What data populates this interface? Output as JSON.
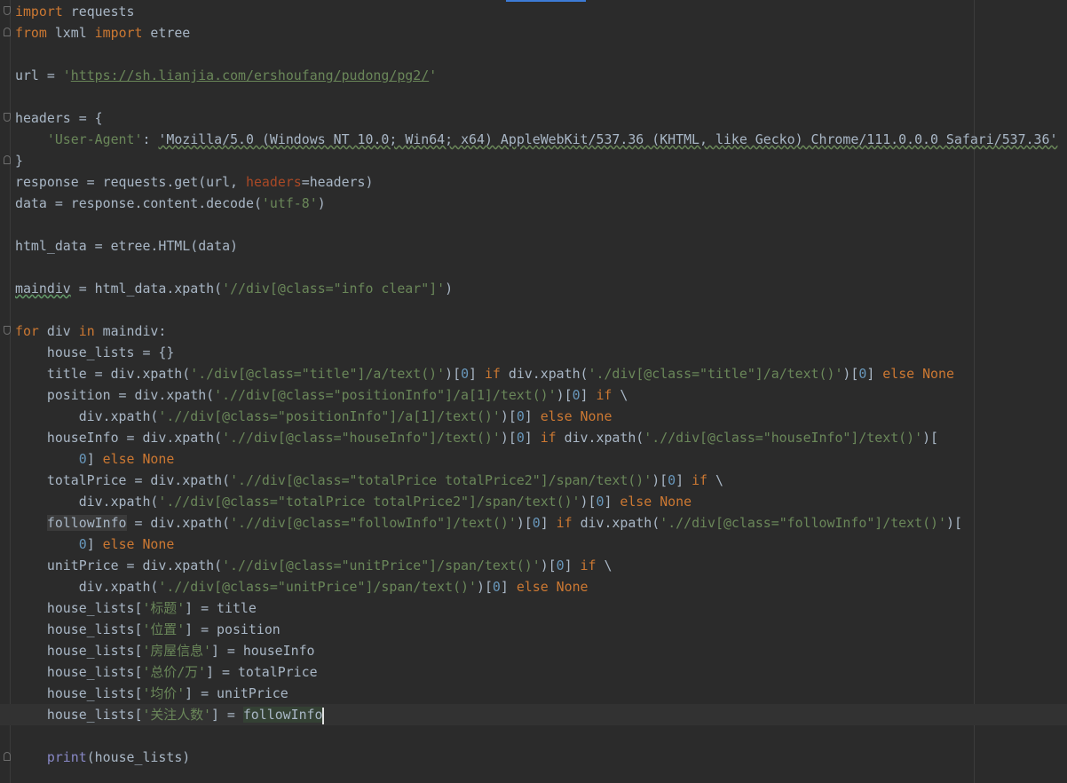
{
  "editor": {
    "theme_colors": {
      "background": "#2b2b2b",
      "keyword": "#cc7832",
      "string": "#6a8759",
      "number": "#6897bb",
      "identifier": "#a9b7c6",
      "kwarg": "#aa4926",
      "builtin": "#8888c6"
    },
    "current_line": 33,
    "lines": [
      {
        "fold": "start",
        "tokens": [
          [
            "kw",
            "import"
          ],
          [
            "id",
            " requests"
          ]
        ]
      },
      {
        "fold": "end",
        "tokens": [
          [
            "kw",
            "from"
          ],
          [
            "id",
            " lxml "
          ],
          [
            "kw",
            "import"
          ],
          [
            "id",
            " etree"
          ]
        ]
      },
      {
        "tokens": []
      },
      {
        "tokens": [
          [
            "id",
            "url = "
          ],
          [
            "str",
            "'"
          ],
          [
            "url",
            "https://sh.lianjia.com/ershoufang/pudong/pg2/"
          ],
          [
            "str",
            "'"
          ]
        ]
      },
      {
        "tokens": []
      },
      {
        "fold": "start",
        "tokens": [
          [
            "id",
            "headers = {"
          ]
        ]
      },
      {
        "tokens": [
          [
            "id",
            "    "
          ],
          [
            "str",
            "'User-Agent'"
          ],
          [
            "id",
            ": "
          ],
          [
            "wavy",
            "'Mozilla/5.0 (Windows NT 10.0; Win64; x64) AppleWebKit/537.36 (KHTML, like Gecko) Chrome/111.0.0.0 Safari/537.36'"
          ]
        ]
      },
      {
        "fold": "end",
        "tokens": [
          [
            "id",
            "}"
          ]
        ]
      },
      {
        "tokens": [
          [
            "id",
            "response = requests.get(url, "
          ],
          [
            "kwarg",
            "headers"
          ],
          [
            "id",
            "=headers)"
          ]
        ]
      },
      {
        "tokens": [
          [
            "id",
            "data = response.content.decode("
          ],
          [
            "str",
            "'utf-8'"
          ],
          [
            "id",
            ")"
          ]
        ]
      },
      {
        "tokens": []
      },
      {
        "tokens": [
          [
            "id",
            "html_data = etree.HTML(data)"
          ]
        ]
      },
      {
        "tokens": []
      },
      {
        "tokens": [
          [
            "typo",
            "maindiv"
          ],
          [
            "id",
            " = html_data.xpath("
          ],
          [
            "str",
            "'//div[@class=\"info clear\"]'"
          ],
          [
            "id",
            ")"
          ]
        ]
      },
      {
        "tokens": []
      },
      {
        "fold": "start",
        "tokens": [
          [
            "kw",
            "for"
          ],
          [
            "id",
            " div "
          ],
          [
            "kw",
            "in"
          ],
          [
            "id",
            " maindiv:"
          ]
        ]
      },
      {
        "tokens": [
          [
            "id",
            "    house_lists = {}"
          ]
        ]
      },
      {
        "tokens": [
          [
            "id",
            "    title = div.xpath("
          ],
          [
            "str",
            "'./div[@class=\"title\"]/a/text()'"
          ],
          [
            "id",
            ")["
          ],
          [
            "num",
            "0"
          ],
          [
            "id",
            "] "
          ],
          [
            "kw",
            "if"
          ],
          [
            "id",
            " div.xpath("
          ],
          [
            "str",
            "'./div[@class=\"title\"]/a/text()'"
          ],
          [
            "id",
            ")["
          ],
          [
            "num",
            "0"
          ],
          [
            "id",
            "] "
          ],
          [
            "kw",
            "else None"
          ]
        ]
      },
      {
        "tokens": [
          [
            "id",
            "    position = div.xpath("
          ],
          [
            "str",
            "'.//div[@class=\"positionInfo\"]/a[1]/text()'"
          ],
          [
            "id",
            ")["
          ],
          [
            "num",
            "0"
          ],
          [
            "id",
            "] "
          ],
          [
            "kw",
            "if"
          ],
          [
            "id",
            " \\"
          ]
        ]
      },
      {
        "tokens": [
          [
            "id",
            "        div.xpath("
          ],
          [
            "str",
            "'.//div[@class=\"positionInfo\"]/a[1]/text()'"
          ],
          [
            "id",
            ")["
          ],
          [
            "num",
            "0"
          ],
          [
            "id",
            "] "
          ],
          [
            "kw",
            "else None"
          ]
        ]
      },
      {
        "tokens": [
          [
            "id",
            "    houseInfo = div.xpath("
          ],
          [
            "str",
            "'.//div[@class=\"houseInfo\"]/text()'"
          ],
          [
            "id",
            ")["
          ],
          [
            "num",
            "0"
          ],
          [
            "id",
            "] "
          ],
          [
            "kw",
            "if"
          ],
          [
            "id",
            " div.xpath("
          ],
          [
            "str",
            "'.//div[@class=\"houseInfo\"]/text()'"
          ],
          [
            "id",
            ")["
          ]
        ]
      },
      {
        "tokens": [
          [
            "id",
            "        "
          ],
          [
            "num",
            "0"
          ],
          [
            "id",
            "] "
          ],
          [
            "kw",
            "else None"
          ]
        ]
      },
      {
        "tokens": [
          [
            "id",
            "    totalPrice = div.xpath("
          ],
          [
            "str",
            "'.//div[@class=\"totalPrice totalPrice2\"]/span/text()'"
          ],
          [
            "id",
            ")["
          ],
          [
            "num",
            "0"
          ],
          [
            "id",
            "] "
          ],
          [
            "kw",
            "if"
          ],
          [
            "id",
            " \\"
          ]
        ]
      },
      {
        "tokens": [
          [
            "id",
            "        div.xpath("
          ],
          [
            "str",
            "'.//div[@class=\"totalPrice totalPrice2\"]/span/text()'"
          ],
          [
            "id",
            ")["
          ],
          [
            "num",
            "0"
          ],
          [
            "id",
            "] "
          ],
          [
            "kw",
            "else None"
          ]
        ]
      },
      {
        "tokens": [
          [
            "id",
            "    "
          ],
          [
            "usage2",
            "followInfo"
          ],
          [
            "id",
            " = div.xpath("
          ],
          [
            "str",
            "'.//div[@class=\"followInfo\"]/text()'"
          ],
          [
            "id",
            ")["
          ],
          [
            "num",
            "0"
          ],
          [
            "id",
            "] "
          ],
          [
            "kw",
            "if"
          ],
          [
            "id",
            " div.xpath("
          ],
          [
            "str",
            "'.//div[@class=\"followInfo\"]/text()'"
          ],
          [
            "id",
            ")["
          ]
        ]
      },
      {
        "tokens": [
          [
            "id",
            "        "
          ],
          [
            "num",
            "0"
          ],
          [
            "id",
            "] "
          ],
          [
            "kw",
            "else None"
          ]
        ]
      },
      {
        "tokens": [
          [
            "id",
            "    unitPrice = div.xpath("
          ],
          [
            "str",
            "'.//div[@class=\"unitPrice\"]/span/text()'"
          ],
          [
            "id",
            ")["
          ],
          [
            "num",
            "0"
          ],
          [
            "id",
            "] "
          ],
          [
            "kw",
            "if"
          ],
          [
            "id",
            " \\"
          ]
        ]
      },
      {
        "tokens": [
          [
            "id",
            "        div.xpath("
          ],
          [
            "str",
            "'.//div[@class=\"unitPrice\"]/span/text()'"
          ],
          [
            "id",
            ")["
          ],
          [
            "num",
            "0"
          ],
          [
            "id",
            "] "
          ],
          [
            "kw",
            "else None"
          ]
        ]
      },
      {
        "tokens": [
          [
            "id",
            "    house_lists["
          ],
          [
            "str",
            "'标题'"
          ],
          [
            "id",
            "] = title"
          ]
        ]
      },
      {
        "tokens": [
          [
            "id",
            "    house_lists["
          ],
          [
            "str",
            "'位置'"
          ],
          [
            "id",
            "] = position"
          ]
        ]
      },
      {
        "tokens": [
          [
            "id",
            "    house_lists["
          ],
          [
            "str",
            "'房屋信息'"
          ],
          [
            "id",
            "] = houseInfo"
          ]
        ]
      },
      {
        "tokens": [
          [
            "id",
            "    house_lists["
          ],
          [
            "str",
            "'总价/万'"
          ],
          [
            "id",
            "] = totalPrice"
          ]
        ]
      },
      {
        "tokens": [
          [
            "id",
            "    house_lists["
          ],
          [
            "str",
            "'均价'"
          ],
          [
            "id",
            "] = unitPrice"
          ]
        ]
      },
      {
        "tokens": [
          [
            "id",
            "    house_lists["
          ],
          [
            "str",
            "'关注人数'"
          ],
          [
            "id",
            "] = "
          ],
          [
            "usage",
            "followInfo"
          ],
          [
            "caret",
            ""
          ]
        ]
      },
      {
        "tokens": []
      },
      {
        "fold": "end",
        "tokens": [
          [
            "id",
            "    "
          ],
          [
            "builtin",
            "print"
          ],
          [
            "id",
            "(house_lists)"
          ]
        ]
      }
    ]
  }
}
